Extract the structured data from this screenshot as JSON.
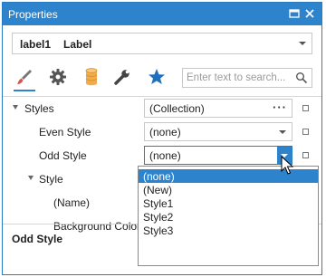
{
  "window": {
    "title": "Properties"
  },
  "object_selector": {
    "name": "label1",
    "type": "Label"
  },
  "tabs": [
    {
      "icon": "brush-icon"
    },
    {
      "icon": "gear-icon"
    },
    {
      "icon": "database-icon"
    },
    {
      "icon": "wrench-icon"
    },
    {
      "icon": "star-icon"
    }
  ],
  "search": {
    "placeholder": "Enter text to search...",
    "value": ""
  },
  "properties": {
    "styles": {
      "label": "Styles",
      "value": "(Collection)"
    },
    "even_style": {
      "label": "Even Style",
      "value": "(none)"
    },
    "odd_style": {
      "label": "Odd Style",
      "value": "(none)"
    },
    "style": {
      "label": "Style"
    },
    "name": {
      "label": "(Name)"
    },
    "background_color": {
      "label": "Background Color"
    }
  },
  "dropdown": {
    "options": [
      "(none)",
      "(New)",
      "Style1",
      "Style2",
      "Style3"
    ],
    "selected": "(none)"
  },
  "description": {
    "title": "Odd Style"
  },
  "colors": {
    "accent": "#2e84cc",
    "border": "#c8c8c8",
    "star": "#1f6fbf",
    "brush": "#d9534f"
  }
}
